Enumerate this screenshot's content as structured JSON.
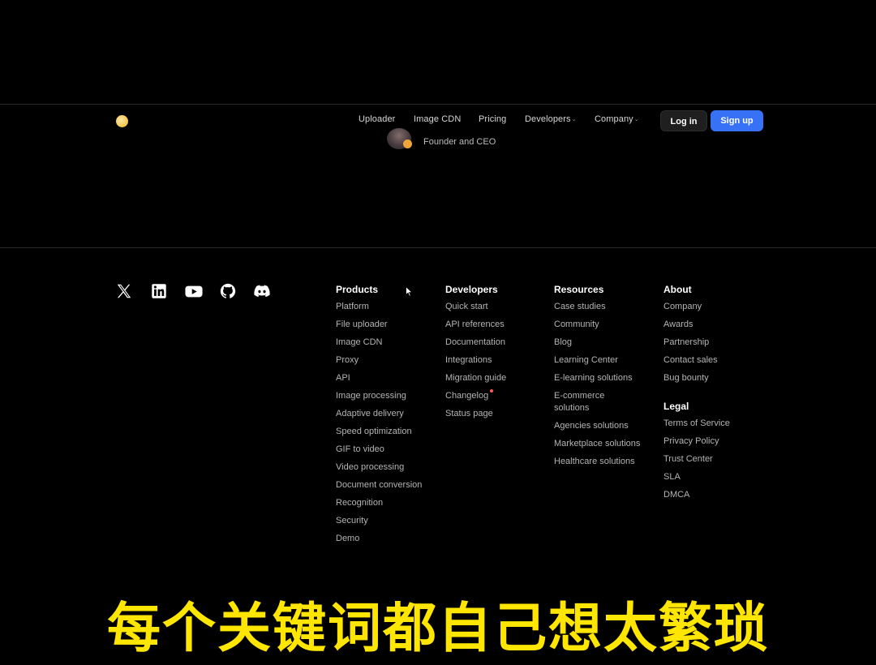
{
  "nav": {
    "links": [
      "Uploader",
      "Image CDN",
      "Pricing",
      "Developers",
      "Company"
    ],
    "dropdown_caret": "⌄",
    "login_label": "Log in",
    "signup_label": "Sign up"
  },
  "quote": {
    "author_role": "Founder and CEO"
  },
  "social": {
    "icons": [
      "x-icon",
      "linkedin-icon",
      "youtube-icon",
      "github-icon",
      "discord-icon"
    ]
  },
  "footer": {
    "products": {
      "title": "Products",
      "links": [
        "Platform",
        "File uploader",
        "Image CDN",
        "Proxy",
        "API",
        "Image processing",
        "Adaptive delivery",
        "Speed optimization",
        "GIF to video",
        "Video processing",
        "Document conversion",
        "Recognition",
        "Security",
        "Demo"
      ]
    },
    "developers": {
      "title": "Developers",
      "links": [
        "Quick start",
        "API references",
        "Documentation",
        "Integrations",
        "Migration guide",
        "Changelog",
        "Status page"
      ]
    },
    "resources": {
      "title": "Resources",
      "links": [
        "Case studies",
        "Community",
        "Blog",
        "Learning Center",
        "E-learning solutions",
        "E-commerce solutions",
        "Agencies solutions",
        "Marketplace solutions",
        "Healthcare solutions"
      ]
    },
    "about": {
      "title": "About",
      "links": [
        "Company",
        "Awards",
        "Partnership",
        "Contact sales",
        "Bug bounty"
      ]
    },
    "legal": {
      "title": "Legal",
      "links": [
        "Terms of Service",
        "Privacy Policy",
        "Trust Center",
        "SLA",
        "DMCA"
      ]
    }
  },
  "caption": "每个关键词都自己想太繁琐",
  "colors": {
    "background": "#000000",
    "accent": "#3771f5",
    "caption": "#ffe600",
    "new_dot": "#ff5a5a"
  }
}
